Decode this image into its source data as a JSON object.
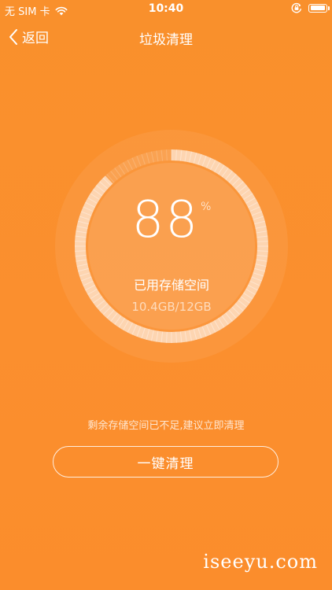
{
  "status_bar": {
    "carrier": "无 SIM 卡",
    "time": "10:40",
    "battery_level": 0.95
  },
  "nav": {
    "back_label": "返回",
    "title": "垃圾清理"
  },
  "gauge": {
    "percent": "88",
    "percent_unit": "%",
    "used_fraction": 0.88,
    "caption": "已用存储空间",
    "usage": "10.4GB/12GB"
  },
  "hint": "剩余存储空间已不足,建议立即清理",
  "action": {
    "label": "一键清理"
  },
  "watermark": "iseeyu.com",
  "colors": {
    "background": "#fb8f2e",
    "text": "#ffffff"
  }
}
